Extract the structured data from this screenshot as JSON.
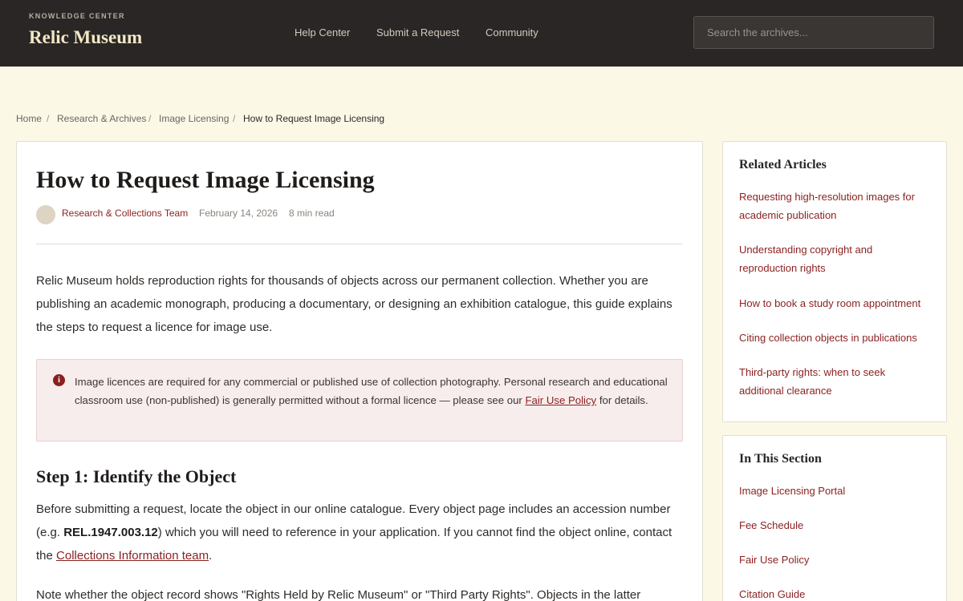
{
  "header": {
    "kicker": "KNOWLEDGE CENTER",
    "brand": "Relic Museum",
    "nav": [
      "Help Center",
      "Submit a Request",
      "Community"
    ],
    "search_placeholder": "Search the archives..."
  },
  "breadcrumb": {
    "items": [
      "Home",
      "Research & Archives",
      "Image Licensing"
    ],
    "current": "How to Request Image Licensing"
  },
  "article": {
    "title": "How to Request Image Licensing",
    "author": "Research & Collections Team",
    "date": "February 14, 2026",
    "read_time": "8 min read",
    "intro": "Relic Museum holds reproduction rights for thousands of objects across our permanent collection. Whether you are publishing an academic monograph, producing a documentary, or designing an exhibition catalogue, this guide explains the steps to request a licence for image use.",
    "callout": {
      "icon": "info-icon",
      "text_before": "Image licences are required for any commercial or published use of collection photography. Personal research and educational classroom use (non-published) is generally permitted without a formal licence — please see our ",
      "link": "Fair Use Policy",
      "text_after": " for details."
    },
    "step1": {
      "heading": "Step 1: Identify the Object",
      "text_a": "Before submitting a request, locate the object in our online catalogue. Every object page includes an accession number (e.g. ",
      "accession": "REL.1947.003.12",
      "text_b": ") which you will need to reference in your application. If you cannot find the object online, contact the ",
      "link": "Collections Information team",
      "text_c": "."
    },
    "para2": "Note whether the object record shows \"Rights Held by Relic Museum\" or \"Third Party Rights\". Objects in the latter"
  },
  "sidebar": {
    "related": {
      "heading": "Related Articles",
      "items": [
        "Requesting high-resolution images for academic publication",
        "Understanding copyright and reproduction rights",
        "How to book a study room appointment",
        "Citing collection objects in publications",
        "Third-party rights: when to seek additional clearance"
      ]
    },
    "section": {
      "heading": "In This Section",
      "items": [
        "Image Licensing Portal",
        "Fee Schedule",
        "Fair Use Policy",
        "Citation Guide"
      ]
    }
  },
  "colors": {
    "accent": "#8b1f1f",
    "header_bg": "#2a2625",
    "page_bg": "#fcf8e6",
    "callout_bg": "#f8eded"
  }
}
